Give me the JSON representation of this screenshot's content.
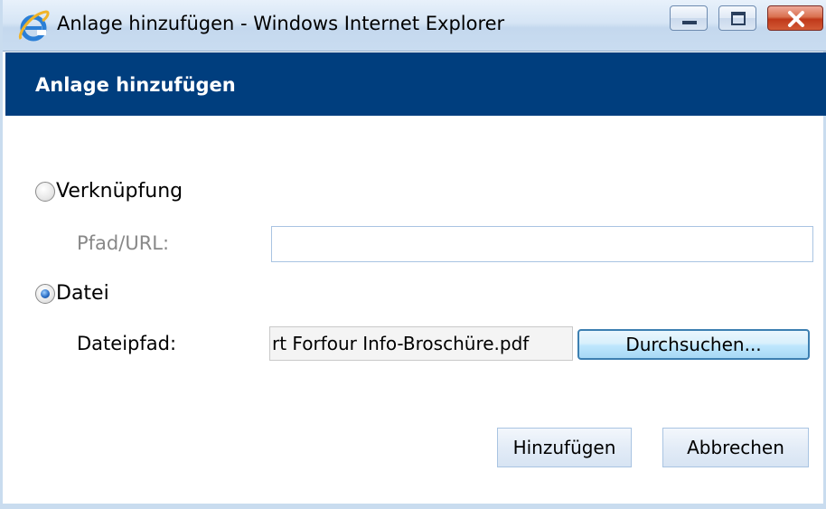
{
  "window": {
    "title": "Anlage hinzufügen - Windows Internet Explorer",
    "icon": "internet-explorer-icon",
    "controls": [
      "minimize-icon",
      "maximize-icon",
      "close-icon"
    ]
  },
  "dialog": {
    "header_title": "Anlage hinzufügen",
    "header_color": "#003e7e",
    "options": {
      "link": {
        "label": "Verknüpfung",
        "checked": false
      },
      "file": {
        "label": "Datei",
        "checked": true
      }
    },
    "path_url": {
      "label": "Pfad/URL:",
      "value": "",
      "placeholder": ""
    },
    "file_path": {
      "label": "Dateipfad:",
      "value": "rt Forfour Info-Broschüre.pdf"
    },
    "browse_button": "Durchsuchen...",
    "add_button": "Hinzufügen",
    "cancel_button": "Abbrechen"
  }
}
